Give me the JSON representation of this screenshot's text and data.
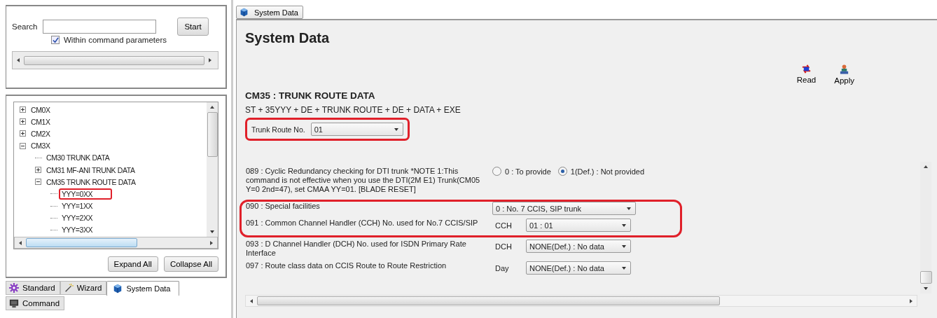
{
  "search": {
    "label": "Search",
    "button": "Start",
    "within": {
      "label": "Within command parameters",
      "checked": true
    }
  },
  "tree": [
    {
      "label": "CM0X",
      "expanded": false
    },
    {
      "label": "CM1X",
      "expanded": false
    },
    {
      "label": "CM2X",
      "expanded": false
    },
    {
      "label": "CM3X",
      "expanded": true,
      "children": [
        {
          "label": "CM30 TRUNK DATA"
        },
        {
          "label": "CM31 MF-ANI TRUNK DATA",
          "expanded": false
        },
        {
          "label": "CM35 TRUNK ROUTE DATA",
          "expanded": true,
          "children": [
            {
              "label": "YYY=0XX",
              "highlighted": true
            },
            {
              "label": "YYY=1XX",
              "highlighted": false
            },
            {
              "label": "YYY=2XX",
              "highlighted": false
            },
            {
              "label": "YYY=3XX",
              "highlighted": false
            }
          ]
        }
      ]
    }
  ],
  "tree_buttons": [
    "Expand All",
    "Collapse All"
  ],
  "bottom_tabs": [
    {
      "label": "Standard",
      "selected": false
    },
    {
      "label": "Wizard",
      "selected": false
    },
    {
      "label": "System Data",
      "selected": true
    },
    {
      "label": "Command",
      "selected": false
    }
  ],
  "doc_tab": {
    "label": "System Data",
    "selected": true
  },
  "title": "System Data",
  "actions": [
    {
      "label": "Read"
    },
    {
      "label": "Apply"
    }
  ],
  "command": {
    "heading": "CM35 : TRUNK ROUTE DATA",
    "syntax": "ST + 35YYY + DE + TRUNK ROUTE + DE + DATA + EXE"
  },
  "trunk_route": {
    "label": "Trunk Route No.",
    "value": "01",
    "highlighted": true
  },
  "param_groups": [
    {
      "highlighted": false,
      "items": [
        {
          "kind": "radio",
          "label": "089 : Cyclic Redundancy checking for DTI trunk *NOTE 1:This command is not effective when you use the DTI(2M E1) Trunk(CM05 Y=0 2nd=47), set CMAA YY=01. [BLADE RESET]",
          "options": [
            {
              "label": "0 : To provide",
              "selected": false
            },
            {
              "label": "1(Def.) : Not provided",
              "selected": true
            }
          ]
        }
      ]
    },
    {
      "highlighted": true,
      "items": [
        {
          "kind": "select",
          "label": "090 : Special facilities",
          "value": "0 : No. 7 CCIS, SIP trunk"
        },
        {
          "kind": "select",
          "label": "091 : Common Channel Handler (CCH) No. used for No.7 CCIS/SIP",
          "prefix": "CCH",
          "value": "01 :  01"
        }
      ]
    },
    {
      "highlighted": false,
      "items": [
        {
          "kind": "select",
          "label": "093 : D Channel Handler (DCH) No. used for ISDN Primary Rate Interface",
          "prefix": "DCH",
          "value": "NONE(Def.) : No data"
        },
        {
          "kind": "select",
          "label": "097 : Route class data on CCIS Route to Route Restriction",
          "prefix": "Day",
          "value": "NONE(Def.) : No data"
        }
      ]
    }
  ]
}
